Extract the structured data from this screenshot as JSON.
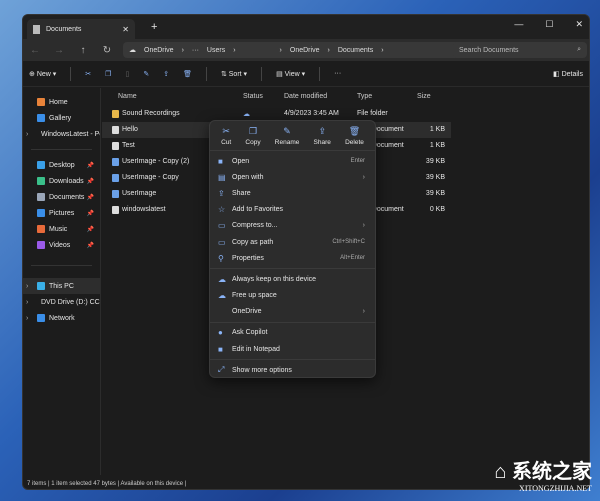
{
  "window": {
    "tab_title": "Documents"
  },
  "address": {
    "crumbs": [
      "OneDrive",
      "···",
      "Users",
      "OneDrive",
      "Documents"
    ],
    "search_placeholder": "Search Documents"
  },
  "toolbar": {
    "new": "New",
    "sort": "Sort",
    "view": "View",
    "more": "···",
    "details": "Details"
  },
  "sidebar": {
    "items": [
      {
        "label": "Home",
        "color": "#e8833a"
      },
      {
        "label": "Gallery",
        "color": "#3a8ee8"
      },
      {
        "label": "WindowsLatest - Pe",
        "color": "#3a8ee8",
        "chev": true
      }
    ],
    "pinned": [
      {
        "label": "Desktop",
        "color": "#3aa0e8"
      },
      {
        "label": "Downloads",
        "color": "#3ac08a"
      },
      {
        "label": "Documents",
        "color": "#9aa6b8"
      },
      {
        "label": "Pictures",
        "color": "#3a8ee8"
      },
      {
        "label": "Music",
        "color": "#e86a3a"
      },
      {
        "label": "Videos",
        "color": "#9a5ae8"
      }
    ],
    "devices": [
      {
        "label": "This PC",
        "color": "#3ab0e8"
      },
      {
        "label": "DVD Drive (D:) CCC",
        "color": "#3ac0a0"
      },
      {
        "label": "Network",
        "color": "#3a8ee8"
      }
    ]
  },
  "columns": {
    "name": "Name",
    "status": "Status",
    "date": "Date modified",
    "type": "Type",
    "size": "Size"
  },
  "files": [
    {
      "name": "Sound Recordings",
      "status": "☁",
      "date": "4/9/2023 3:45 AM",
      "type": "File folder",
      "size": "",
      "folder": true
    },
    {
      "name": "Hello",
      "status": "",
      "date": "",
      "type": "Text Document",
      "size": "1 KB"
    },
    {
      "name": "Test",
      "status": "",
      "date": "",
      "type": "Text Document",
      "size": "1 KB"
    },
    {
      "name": "UserImage - Copy (2)",
      "status": "",
      "date": "",
      "type": "",
      "size": "39 KB"
    },
    {
      "name": "UserImage - Copy",
      "status": "",
      "date": "",
      "type": "",
      "size": "39 KB"
    },
    {
      "name": "UserImage",
      "status": "",
      "date": "",
      "type": "",
      "size": "39 KB"
    },
    {
      "name": "windowslatest",
      "status": "",
      "date": "",
      "type": "Text Document",
      "size": "0 KB"
    }
  ],
  "status_bar": "7 items  |  1 item selected  47 bytes  |  Available on this device  |",
  "menu": {
    "quick": [
      {
        "label": "Cut",
        "icon": "✂"
      },
      {
        "label": "Copy",
        "icon": "❐"
      },
      {
        "label": "Rename",
        "icon": "✎"
      },
      {
        "label": "Share",
        "icon": "⇪"
      },
      {
        "label": "Delete",
        "icon": "🗑"
      }
    ],
    "groups": [
      [
        {
          "label": "Open",
          "icon": "■",
          "shortcut": "Enter"
        },
        {
          "label": "Open with",
          "icon": "▤",
          "sub": true
        },
        {
          "label": "Share",
          "icon": "⇪"
        },
        {
          "label": "Add to Favorites",
          "icon": "☆"
        },
        {
          "label": "Compress to...",
          "icon": "▭",
          "sub": true
        },
        {
          "label": "Copy as path",
          "icon": "▭",
          "shortcut": "Ctrl+Shift+C"
        },
        {
          "label": "Properties",
          "icon": "⚲",
          "shortcut": "Alt+Enter"
        }
      ],
      [
        {
          "label": "Always keep on this device",
          "icon": "☁"
        },
        {
          "label": "Free up space",
          "icon": "☁"
        },
        {
          "label": "OneDrive",
          "icon": "",
          "sub": true
        }
      ],
      [
        {
          "label": "Ask Copilot",
          "icon": "●"
        },
        {
          "label": "Edit in Notepad",
          "icon": "■"
        }
      ],
      [
        {
          "label": "Show more options",
          "icon": "⤢"
        }
      ]
    ]
  },
  "watermark": {
    "brand": "系统之家",
    "site": "XITONGZHIJIA.NET"
  }
}
